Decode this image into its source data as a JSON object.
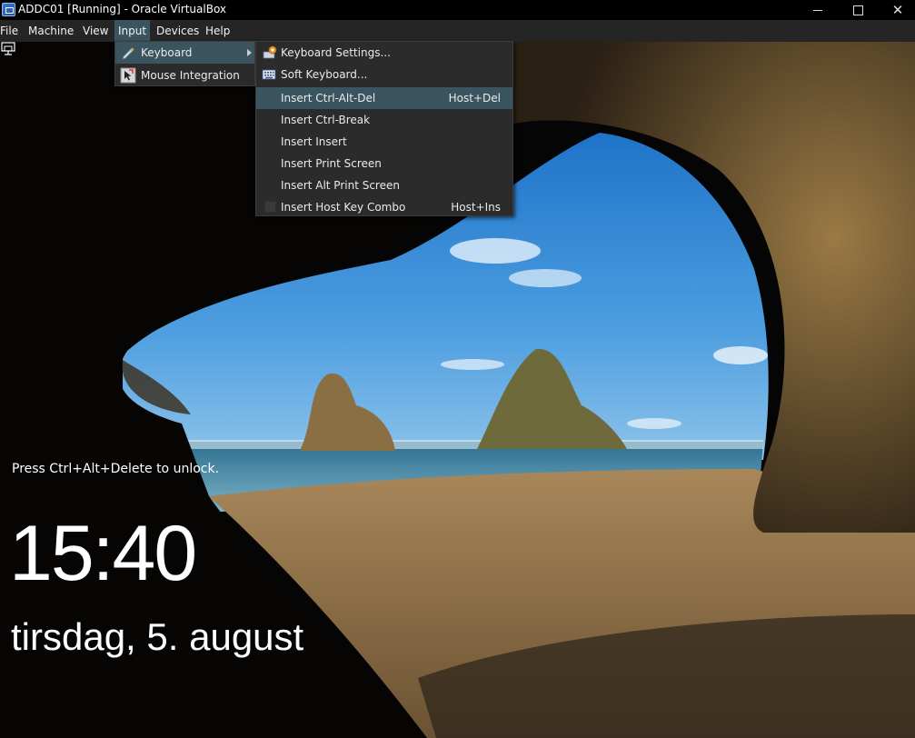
{
  "window": {
    "title": "ADDC01 [Running] - Oracle VirtualBox",
    "minimize_glyph": "",
    "close_glyph": "✕"
  },
  "menubar": {
    "items": [
      {
        "label": "File"
      },
      {
        "label": "Machine"
      },
      {
        "label": "View"
      },
      {
        "label": "Input",
        "active": true
      },
      {
        "label": "Devices"
      },
      {
        "label": "Help"
      }
    ]
  },
  "input_menu": {
    "items": [
      {
        "label": "Keyboard",
        "icon": "keyboard-pen-icon",
        "has_submenu": true
      },
      {
        "label": "Mouse Integration",
        "icon": "mouse-integration-icon"
      }
    ]
  },
  "keyboard_menu": {
    "items": [
      {
        "label": "Keyboard Settings...",
        "icon": "keyboard-settings-icon"
      },
      {
        "label": "Soft Keyboard...",
        "icon": "soft-keyboard-icon"
      },
      {
        "label": "Insert Ctrl-Alt-Del",
        "shortcut": "Host+Del",
        "highlighted": true
      },
      {
        "label": "Insert Ctrl-Break"
      },
      {
        "label": "Insert Insert"
      },
      {
        "label": "Insert Print Screen"
      },
      {
        "label": "Insert Alt Print Screen"
      },
      {
        "label": "Insert Host Key Combo",
        "shortcut": "Host+Ins",
        "checkbox": true
      }
    ]
  },
  "lockscreen": {
    "message": "Press Ctrl+Alt+Delete to unlock.",
    "time": "15:40",
    "date": "tirsdag, 5. august",
    "icon": "network-icon"
  },
  "colors": {
    "highlight": "#3b5560",
    "menu_bg": "#2b2b2b",
    "menubar_bg": "#252525"
  }
}
